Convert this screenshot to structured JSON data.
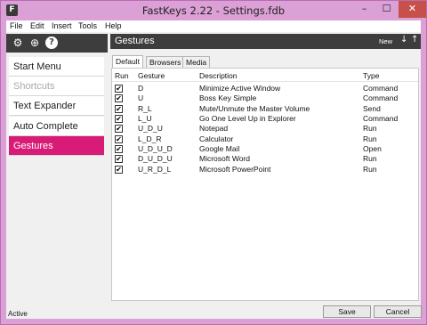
{
  "window": {
    "title": "FastKeys 2.22  -  Settings.fdb",
    "icon_glyph": "F",
    "controls": {
      "minimize": "–",
      "maximize": "☐",
      "close": "✕"
    }
  },
  "menu": [
    "File",
    "Edit",
    "Insert",
    "Tools",
    "Help"
  ],
  "toolbar": {
    "icons": [
      "gear-icon",
      "globe-icon",
      "help-icon"
    ],
    "glyphs": [
      "⚙",
      "⊕",
      "?"
    ]
  },
  "sidebar": {
    "items": [
      {
        "label": "Start Menu",
        "state": "normal"
      },
      {
        "label": "Shortcuts",
        "state": "disabled"
      },
      {
        "label": "Text Expander",
        "state": "normal"
      },
      {
        "label": "Auto Complete",
        "state": "normal"
      },
      {
        "label": "Gestures",
        "state": "active"
      }
    ]
  },
  "main": {
    "title": "Gestures",
    "new_label": "New",
    "down_arrow": "↓",
    "up_arrow": "↑"
  },
  "tabs": [
    {
      "label": "Default",
      "active": true
    },
    {
      "label": "Browsers",
      "active": false
    },
    {
      "label": "Media",
      "active": false
    }
  ],
  "table": {
    "columns": [
      "Run",
      "Gesture",
      "Description",
      "Type"
    ],
    "check_glyph": "✔",
    "rows": [
      {
        "run": true,
        "gesture": "D",
        "description": "Minimize Active Window",
        "type": "Command"
      },
      {
        "run": true,
        "gesture": "U",
        "description": "Boss Key Simple",
        "type": "Command"
      },
      {
        "run": true,
        "gesture": "R_L",
        "description": "Mute/Unmute the Master Volume",
        "type": "Send"
      },
      {
        "run": true,
        "gesture": "L_U",
        "description": "Go One Level Up in Explorer",
        "type": "Command"
      },
      {
        "run": true,
        "gesture": "U_D_U",
        "description": "Notepad",
        "type": "Run"
      },
      {
        "run": true,
        "gesture": "L_D_R",
        "description": "Calculator",
        "type": "Run"
      },
      {
        "run": true,
        "gesture": "U_D_U_D",
        "description": "Google Mail",
        "type": "Open"
      },
      {
        "run": true,
        "gesture": "D_U_D_U",
        "description": "Microsoft Word",
        "type": "Run"
      },
      {
        "run": true,
        "gesture": "U_R_D_L",
        "description": "Microsoft PowerPoint",
        "type": "Run"
      }
    ]
  },
  "status": {
    "text": "Active"
  },
  "buttons": {
    "save": "Save",
    "cancel": "Cancel"
  },
  "colors": {
    "accent": "#d81b76",
    "header_dark": "#3d3d3d",
    "window_frame": "#dba0d6",
    "close": "#c7504b"
  }
}
